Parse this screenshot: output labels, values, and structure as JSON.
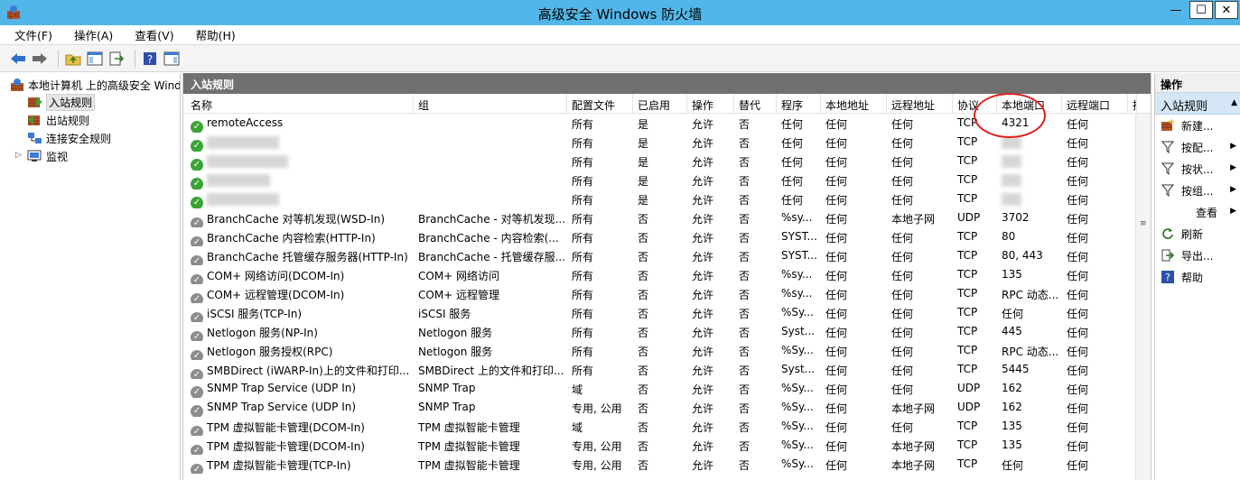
{
  "window": {
    "title": "高级安全 Windows 防火墙",
    "minimize_glyph": "—",
    "maximize_glyph": "☐",
    "close_glyph": "✕"
  },
  "menu": [
    "文件(F)",
    "操作(A)",
    "查看(V)",
    "帮助(H)"
  ],
  "nav": {
    "root": "本地计算机 上的高级安全 Windows",
    "items": [
      "入站规则",
      "出站规则",
      "连接安全规则",
      "监视"
    ],
    "selected": "入站规则"
  },
  "panel": {
    "title": "入站规则",
    "columns": [
      "名称",
      "组",
      "配置文件",
      "已启用",
      "操作",
      "替代",
      "程序",
      "本地地址",
      "远程地址",
      "协议",
      "本地端口",
      "远程端口",
      "授"
    ]
  },
  "rules": [
    {
      "status": "enabled",
      "name": "remoteAccess",
      "group": "",
      "profile": "所有",
      "enabled": "是",
      "action": "允许",
      "override": "否",
      "program": "任何",
      "local_addr": "任何",
      "remote_addr": "任何",
      "protocol": "TCP",
      "local_port": "4321",
      "remote_port": "任何"
    },
    {
      "status": "enabled",
      "name": "",
      "group": "",
      "profile": "所有",
      "enabled": "是",
      "action": "允许",
      "override": "否",
      "program": "任何",
      "local_addr": "任何",
      "remote_addr": "任何",
      "protocol": "TCP",
      "local_port": "",
      "remote_port": "任何",
      "blurred": true
    },
    {
      "status": "enabled",
      "name": "",
      "group": "",
      "profile": "所有",
      "enabled": "是",
      "action": "允许",
      "override": "否",
      "program": "任何",
      "local_addr": "任何",
      "remote_addr": "任何",
      "protocol": "TCP",
      "local_port": "",
      "remote_port": "任何",
      "blurred": true
    },
    {
      "status": "enabled",
      "name": "",
      "group": "",
      "profile": "所有",
      "enabled": "是",
      "action": "允许",
      "override": "否",
      "program": "任何",
      "local_addr": "任何",
      "remote_addr": "任何",
      "protocol": "TCP",
      "local_port": "",
      "remote_port": "任何",
      "blurred": true
    },
    {
      "status": "enabled",
      "name": "",
      "group": "",
      "profile": "所有",
      "enabled": "是",
      "action": "允许",
      "override": "否",
      "program": "任何",
      "local_addr": "任何",
      "remote_addr": "任何",
      "protocol": "TCP",
      "local_port": "",
      "remote_port": "任何",
      "blurred": true
    },
    {
      "status": "disabled",
      "name": "BranchCache 对等机发现(WSD-In)",
      "group": "BranchCache - 对等机发现...",
      "profile": "所有",
      "enabled": "否",
      "action": "允许",
      "override": "否",
      "program": "%sy...",
      "local_addr": "任何",
      "remote_addr": "本地子网",
      "protocol": "UDP",
      "local_port": "3702",
      "remote_port": "任何"
    },
    {
      "status": "disabled",
      "name": "BranchCache 内容检索(HTTP-In)",
      "group": "BranchCache - 内容检索(...",
      "profile": "所有",
      "enabled": "否",
      "action": "允许",
      "override": "否",
      "program": "SYST...",
      "local_addr": "任何",
      "remote_addr": "任何",
      "protocol": "TCP",
      "local_port": "80",
      "remote_port": "任何"
    },
    {
      "status": "disabled",
      "name": "BranchCache 托管缓存服务器(HTTP-In)",
      "group": "BranchCache - 托管缓存服...",
      "profile": "所有",
      "enabled": "否",
      "action": "允许",
      "override": "否",
      "program": "SYST...",
      "local_addr": "任何",
      "remote_addr": "任何",
      "protocol": "TCP",
      "local_port": "80, 443",
      "remote_port": "任何"
    },
    {
      "status": "disabled",
      "name": "COM+ 网络访问(DCOM-In)",
      "group": "COM+ 网络访问",
      "profile": "所有",
      "enabled": "否",
      "action": "允许",
      "override": "否",
      "program": "%sy...",
      "local_addr": "任何",
      "remote_addr": "任何",
      "protocol": "TCP",
      "local_port": "135",
      "remote_port": "任何"
    },
    {
      "status": "disabled",
      "name": "COM+ 远程管理(DCOM-In)",
      "group": "COM+ 远程管理",
      "profile": "所有",
      "enabled": "否",
      "action": "允许",
      "override": "否",
      "program": "%sy...",
      "local_addr": "任何",
      "remote_addr": "任何",
      "protocol": "TCP",
      "local_port": "RPC 动态...",
      "remote_port": "任何"
    },
    {
      "status": "disabled",
      "name": "iSCSI 服务(TCP-In)",
      "group": "iSCSI 服务",
      "profile": "所有",
      "enabled": "否",
      "action": "允许",
      "override": "否",
      "program": "%Sy...",
      "local_addr": "任何",
      "remote_addr": "任何",
      "protocol": "TCP",
      "local_port": "任何",
      "remote_port": "任何"
    },
    {
      "status": "disabled",
      "name": "Netlogon 服务(NP-In)",
      "group": "Netlogon 服务",
      "profile": "所有",
      "enabled": "否",
      "action": "允许",
      "override": "否",
      "program": "Syst...",
      "local_addr": "任何",
      "remote_addr": "任何",
      "protocol": "TCP",
      "local_port": "445",
      "remote_port": "任何"
    },
    {
      "status": "disabled",
      "name": "Netlogon 服务授权(RPC)",
      "group": "Netlogon 服务",
      "profile": "所有",
      "enabled": "否",
      "action": "允许",
      "override": "否",
      "program": "%Sy...",
      "local_addr": "任何",
      "remote_addr": "任何",
      "protocol": "TCP",
      "local_port": "RPC 动态...",
      "remote_port": "任何"
    },
    {
      "status": "disabled",
      "name": "SMBDirect (iWARP-In)上的文件和打印...",
      "group": "SMBDirect 上的文件和打印...",
      "profile": "所有",
      "enabled": "否",
      "action": "允许",
      "override": "否",
      "program": "Syst...",
      "local_addr": "任何",
      "remote_addr": "任何",
      "protocol": "TCP",
      "local_port": "5445",
      "remote_port": "任何"
    },
    {
      "status": "disabled",
      "name": "SNMP Trap Service (UDP In)",
      "group": "SNMP Trap",
      "profile": "域",
      "enabled": "否",
      "action": "允许",
      "override": "否",
      "program": "%Sy...",
      "local_addr": "任何",
      "remote_addr": "任何",
      "protocol": "UDP",
      "local_port": "162",
      "remote_port": "任何"
    },
    {
      "status": "disabled",
      "name": "SNMP Trap Service (UDP In)",
      "group": "SNMP Trap",
      "profile": "专用, 公用",
      "enabled": "否",
      "action": "允许",
      "override": "否",
      "program": "%Sy...",
      "local_addr": "任何",
      "remote_addr": "本地子网",
      "protocol": "UDP",
      "local_port": "162",
      "remote_port": "任何"
    },
    {
      "status": "disabled",
      "name": "TPM 虚拟智能卡管理(DCOM-In)",
      "group": "TPM 虚拟智能卡管理",
      "profile": "域",
      "enabled": "否",
      "action": "允许",
      "override": "否",
      "program": "%Sy...",
      "local_addr": "任何",
      "remote_addr": "任何",
      "protocol": "TCP",
      "local_port": "135",
      "remote_port": "任何"
    },
    {
      "status": "disabled",
      "name": "TPM 虚拟智能卡管理(DCOM-In)",
      "group": "TPM 虚拟智能卡管理",
      "profile": "专用, 公用",
      "enabled": "否",
      "action": "允许",
      "override": "否",
      "program": "%Sy...",
      "local_addr": "任何",
      "remote_addr": "本地子网",
      "protocol": "TCP",
      "local_port": "135",
      "remote_port": "任何"
    },
    {
      "status": "disabled",
      "name": "TPM 虚拟智能卡管理(TCP-In)",
      "group": "TPM 虚拟智能卡管理",
      "profile": "专用, 公用",
      "enabled": "否",
      "action": "允许",
      "override": "否",
      "program": "%Sy...",
      "local_addr": "任何",
      "remote_addr": "本地子网",
      "protocol": "TCP",
      "local_port": "任何",
      "remote_port": "任何"
    }
  ],
  "actions": {
    "header": "操作",
    "section": "入站规则",
    "items": [
      {
        "label": "新建...",
        "icon": "new-rule-icon",
        "submenu": false
      },
      {
        "label": "按配...",
        "icon": "filter-icon",
        "submenu": true
      },
      {
        "label": "按状...",
        "icon": "filter-icon",
        "submenu": true
      },
      {
        "label": "按组...",
        "icon": "filter-icon",
        "submenu": true
      },
      {
        "label": "查看",
        "icon": "",
        "submenu": true
      },
      {
        "label": "刷新",
        "icon": "refresh-icon",
        "submenu": false
      },
      {
        "label": "导出...",
        "icon": "export-icon",
        "submenu": false
      },
      {
        "label": "帮助",
        "icon": "help-icon",
        "submenu": false
      }
    ]
  },
  "colors": {
    "titlebar": "#52b7e8",
    "panel_header": "#707070",
    "selected_section": "#d5e6f7",
    "enabled_status": "#3aa535",
    "disabled_status": "#8c8c8c",
    "annotation": "#e02020"
  }
}
